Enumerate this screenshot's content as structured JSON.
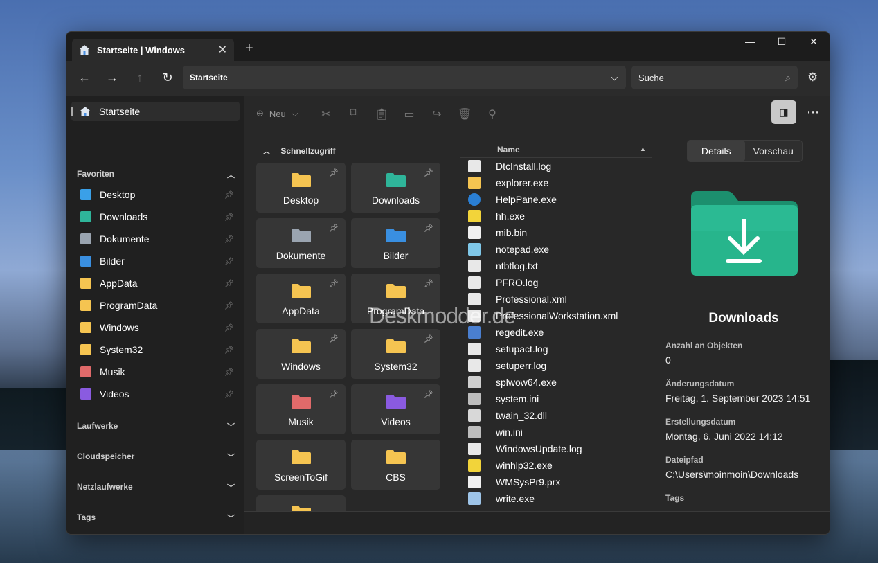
{
  "window": {
    "tab_title": "Startseite | Windows",
    "tab_close": "✕",
    "new_tab": "+",
    "minimize": "—",
    "maximize": "☐",
    "close": "✕"
  },
  "nav": {
    "address": "Startseite",
    "search_placeholder": "Suche"
  },
  "sidebar": {
    "home": "Startseite",
    "favorites_header": "Favoriten",
    "favorites": [
      {
        "label": "Desktop",
        "icon": "desktop-icon",
        "color": "#3aa0e8"
      },
      {
        "label": "Downloads",
        "icon": "download-icon",
        "color": "#2fb59a"
      },
      {
        "label": "Dokumente",
        "icon": "document-icon",
        "color": "#9aa4b0"
      },
      {
        "label": "Bilder",
        "icon": "pictures-icon",
        "color": "#3a8fe0"
      },
      {
        "label": "AppData",
        "icon": "folder-icon",
        "color": "#f5c451"
      },
      {
        "label": "ProgramData",
        "icon": "folder-icon",
        "color": "#f5c451"
      },
      {
        "label": "Windows",
        "icon": "folder-icon",
        "color": "#f5c451"
      },
      {
        "label": "System32",
        "icon": "folder-icon",
        "color": "#f5c451"
      },
      {
        "label": "Musik",
        "icon": "music-icon",
        "color": "#e06a6a"
      },
      {
        "label": "Videos",
        "icon": "video-icon",
        "color": "#8a5be0"
      }
    ],
    "sections": [
      "Laufwerke",
      "Cloudspeicher",
      "Netzlaufwerke",
      "Tags"
    ]
  },
  "toolbar": {
    "new_label": "Neu"
  },
  "quick_access": {
    "title": "Schnellzugriff",
    "tiles": [
      {
        "label": "Desktop",
        "color": "#f5c451",
        "pinned": true
      },
      {
        "label": "Downloads",
        "color": "#2fb59a",
        "pinned": true
      },
      {
        "label": "Dokumente",
        "color": "#9aa4b0",
        "pinned": true
      },
      {
        "label": "Bilder",
        "color": "#3a8fe0",
        "pinned": true
      },
      {
        "label": "AppData",
        "color": "#f5c451",
        "pinned": true
      },
      {
        "label": "ProgramData",
        "color": "#f5c451",
        "pinned": true
      },
      {
        "label": "Windows",
        "color": "#f5c451",
        "pinned": true
      },
      {
        "label": "System32",
        "color": "#f5c451",
        "pinned": true
      },
      {
        "label": "Musik",
        "color": "#e06a6a",
        "pinned": true
      },
      {
        "label": "Videos",
        "color": "#8a5be0",
        "pinned": true
      },
      {
        "label": "ScreenToGif",
        "color": "#f5c451",
        "pinned": false
      },
      {
        "label": "CBS",
        "color": "#f5c451",
        "pinned": false
      }
    ]
  },
  "files": {
    "column_name": "Name",
    "items": [
      {
        "name": "DtcInstall.log",
        "icon": "text-file-icon"
      },
      {
        "name": "explorer.exe",
        "icon": "explorer-icon"
      },
      {
        "name": "HelpPane.exe",
        "icon": "help-icon"
      },
      {
        "name": "hh.exe",
        "icon": "help-exe-icon"
      },
      {
        "name": "mib.bin",
        "icon": "file-icon"
      },
      {
        "name": "notepad.exe",
        "icon": "notepad-icon"
      },
      {
        "name": "ntbtlog.txt",
        "icon": "text-file-icon"
      },
      {
        "name": "PFRO.log",
        "icon": "text-file-icon"
      },
      {
        "name": "Professional.xml",
        "icon": "text-file-icon"
      },
      {
        "name": "ProfessionalWorkstation.xml",
        "icon": "text-file-icon"
      },
      {
        "name": "regedit.exe",
        "icon": "regedit-icon"
      },
      {
        "name": "setupact.log",
        "icon": "text-file-icon"
      },
      {
        "name": "setuperr.log",
        "icon": "text-file-icon"
      },
      {
        "name": "splwow64.exe",
        "icon": "printer-icon"
      },
      {
        "name": "system.ini",
        "icon": "settings-file-icon"
      },
      {
        "name": "twain_32.dll",
        "icon": "dll-icon"
      },
      {
        "name": "win.ini",
        "icon": "settings-file-icon"
      },
      {
        "name": "WindowsUpdate.log",
        "icon": "text-file-icon"
      },
      {
        "name": "winhlp32.exe",
        "icon": "help-exe-icon"
      },
      {
        "name": "WMSysPr9.prx",
        "icon": "file-icon"
      },
      {
        "name": "write.exe",
        "icon": "write-icon"
      }
    ]
  },
  "details": {
    "tab_details": "Details",
    "tab_preview": "Vorschau",
    "name": "Downloads",
    "fields": [
      {
        "label": "Anzahl an Objekten",
        "value": "0"
      },
      {
        "label": "Änderungsdatum",
        "value": "Freitag, 1. September 2023 14:51"
      },
      {
        "label": "Erstellungsdatum",
        "value": "Montag, 6. Juni 2022 14:12"
      },
      {
        "label": "Dateipfad",
        "value": "C:\\Users\\moinmoin\\Downloads"
      }
    ],
    "tags_label": "Tags"
  },
  "watermark": "Deskmodder.de"
}
